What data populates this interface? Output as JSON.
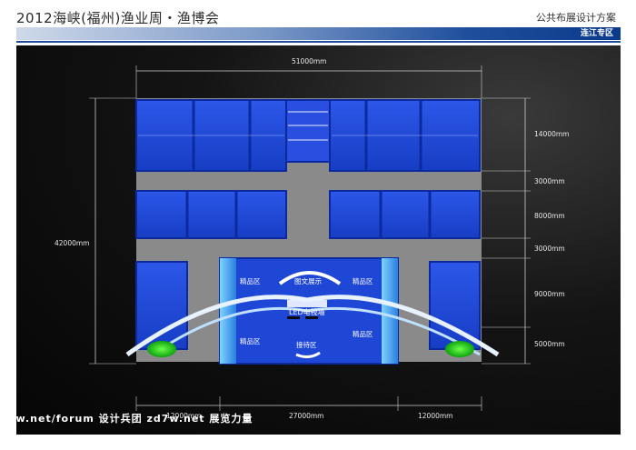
{
  "header": {
    "title": "2012海峡(福州)渔业周・渔博会",
    "subtitle": "公共布展设计方案",
    "section_label": "连江专区"
  },
  "dimensions": {
    "overall_width": "51000mm",
    "overall_depth": "42000mm",
    "right_rows": [
      "14000mm",
      "3000mm",
      "8000mm",
      "3000mm",
      "9000mm",
      "5000mm"
    ],
    "bottom_segments": [
      "12000mm",
      "27000mm",
      "12000mm"
    ]
  },
  "zones": {
    "boutique_1": "精品区",
    "boutique_2": "精品区",
    "boutique_3": "精品区",
    "boutique_4": "精品区",
    "graphic_display": "图文展示",
    "led_wall": "LED电视墙",
    "reception": "接待区"
  },
  "watermark": "d7w.net/forum 设计兵团 zd7w.net 展览力量",
  "colors": {
    "booth_blue": "#1f47d6",
    "booth_dark": "#0c2aa0",
    "floor_gray": "#8a8a8a",
    "accent_green": "#1fd11f",
    "arch_white": "#ffffff"
  }
}
